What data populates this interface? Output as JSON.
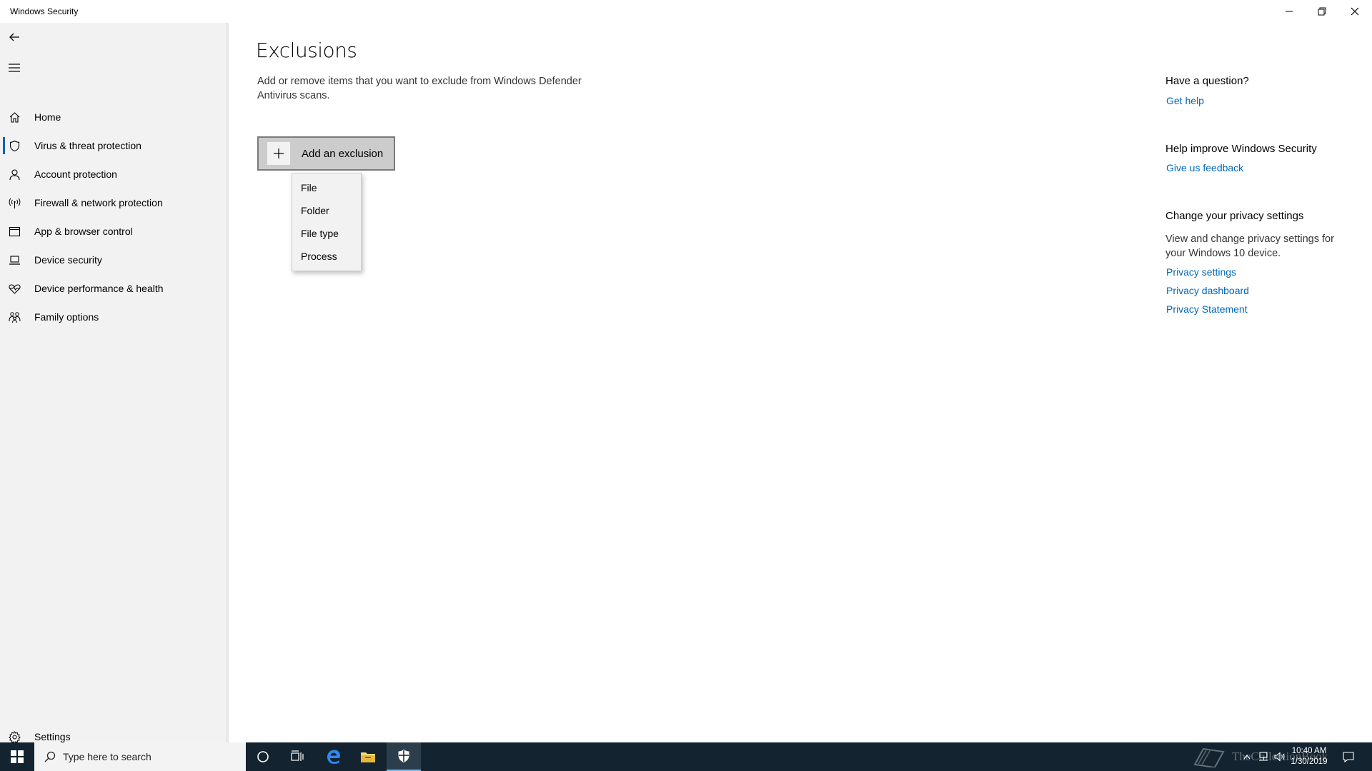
{
  "window": {
    "title": "Windows Security",
    "controls": [
      "minimize",
      "restore",
      "close"
    ]
  },
  "sidebar": {
    "back_icon": "back-arrow-icon",
    "menu_icon": "hamburger-menu-icon",
    "items": [
      {
        "label": "Home",
        "icon": "home-icon"
      },
      {
        "label": "Virus & threat protection",
        "icon": "shield-icon",
        "active": true
      },
      {
        "label": "Account protection",
        "icon": "person-icon"
      },
      {
        "label": "Firewall & network protection",
        "icon": "antenna-icon"
      },
      {
        "label": "App & browser control",
        "icon": "app-window-icon"
      },
      {
        "label": "Device security",
        "icon": "laptop-icon"
      },
      {
        "label": "Device performance & health",
        "icon": "heart-pulse-icon"
      },
      {
        "label": "Family options",
        "icon": "family-icon"
      }
    ],
    "settings": {
      "label": "Settings",
      "icon": "gear-icon"
    }
  },
  "main": {
    "title": "Exclusions",
    "description": "Add or remove items that you want to exclude from Windows Defender Antivirus scans.",
    "add_button": {
      "label": "Add an exclusion",
      "icon": "plus-icon"
    },
    "dropdown": {
      "options": [
        "File",
        "Folder",
        "File type",
        "Process"
      ]
    }
  },
  "help": {
    "question": {
      "heading": "Have a question?",
      "link": "Get help"
    },
    "improve": {
      "heading": "Help improve Windows Security",
      "link": "Give us feedback"
    },
    "privacy": {
      "heading": "Change your privacy settings",
      "text": "View and change privacy settings for your Windows 10 device.",
      "links": [
        "Privacy settings",
        "Privacy dashboard",
        "Privacy Statement"
      ]
    }
  },
  "taskbar": {
    "search_placeholder": "Type here to search",
    "pinned": [
      "cortana-icon",
      "task-view-icon",
      "edge-icon",
      "file-explorer-icon",
      "windows-security-icon"
    ],
    "clock": {
      "time": "10:40 AM",
      "date": "1/30/2019"
    },
    "watermark": "TheCollectionBook",
    "colors": {
      "background": "#13232f",
      "accent": "#76b9ed"
    }
  },
  "colors": {
    "link": "#0067b8",
    "sidebar_bg": "#f2f2f2",
    "active_indicator": "#0063b1",
    "button_bg": "#cccccc"
  }
}
